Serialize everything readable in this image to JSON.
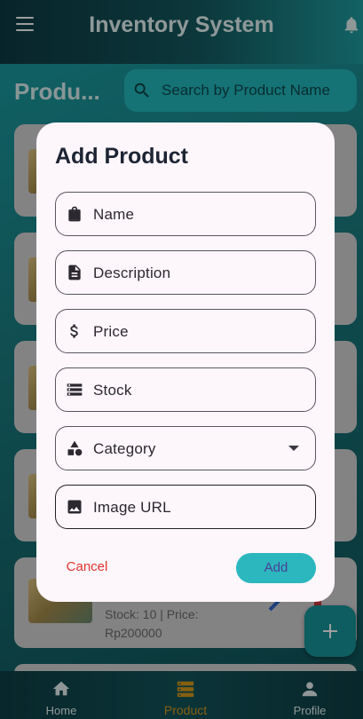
{
  "app": {
    "title": "Inventory System"
  },
  "page": {
    "title": "Produ..."
  },
  "search": {
    "placeholder": "Search by Product Name"
  },
  "product_visible": {
    "stock_price": "Stock: 10 | Price:",
    "price_value": "Rp200000"
  },
  "dialog": {
    "title": "Add Product",
    "fields": [
      {
        "label": "Name",
        "icon": "shopping-bag-icon"
      },
      {
        "label": "Description",
        "icon": "description-icon"
      },
      {
        "label": "Price",
        "icon": "dollar-icon"
      },
      {
        "label": "Stock",
        "icon": "storage-icon"
      },
      {
        "label": "Category",
        "icon": "category-icon"
      },
      {
        "label": "Image URL",
        "icon": "image-icon"
      }
    ],
    "cancel_label": "Cancel",
    "add_label": "Add"
  },
  "bottom_nav": {
    "items": [
      {
        "label": "Home",
        "icon": "home-icon"
      },
      {
        "label": "Product",
        "icon": "product-icon",
        "active": true
      },
      {
        "label": "Profile",
        "icon": "profile-icon"
      }
    ]
  },
  "colors": {
    "accent": "#2bb7bd",
    "active_nav": "#d89a1a",
    "cancel": "#e2342f",
    "dialog_bg": "#fdf6fb"
  }
}
